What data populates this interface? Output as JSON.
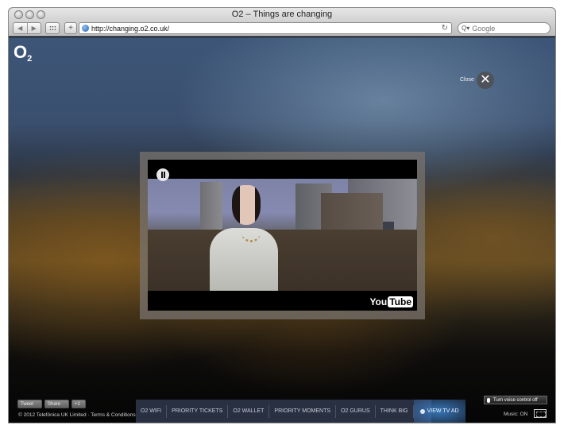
{
  "browser": {
    "window_title": "O2 – Things are changing",
    "back_glyph": "◀",
    "forward_glyph": "▶",
    "add_glyph": "+",
    "url": "http://changing.o2.co.uk/",
    "reload_glyph": "↻",
    "search_placeholder": "Google",
    "search_glyph": "Q▾"
  },
  "page": {
    "logo_main": "O",
    "logo_sub": "2",
    "close_label": "Close",
    "close_glyph": "✕",
    "video": {
      "provider_you": "You",
      "provider_tube": "Tube",
      "state": "playing"
    },
    "social": {
      "tweet": "Tweet",
      "share": "Share",
      "plus": "+1"
    },
    "copyright": "© 2012 Telefónica UK Limited · Terms & Conditions",
    "nav": {
      "items": [
        "O2 WIFI",
        "PRIORITY TICKETS",
        "O2 WALLET",
        "PRIORITY MOMENTS",
        "O2 GURUS",
        "THINK BIG"
      ],
      "active_item": "VIEW TV AD"
    },
    "voice_control": "Turn voice control off",
    "music": "Music: ON"
  }
}
